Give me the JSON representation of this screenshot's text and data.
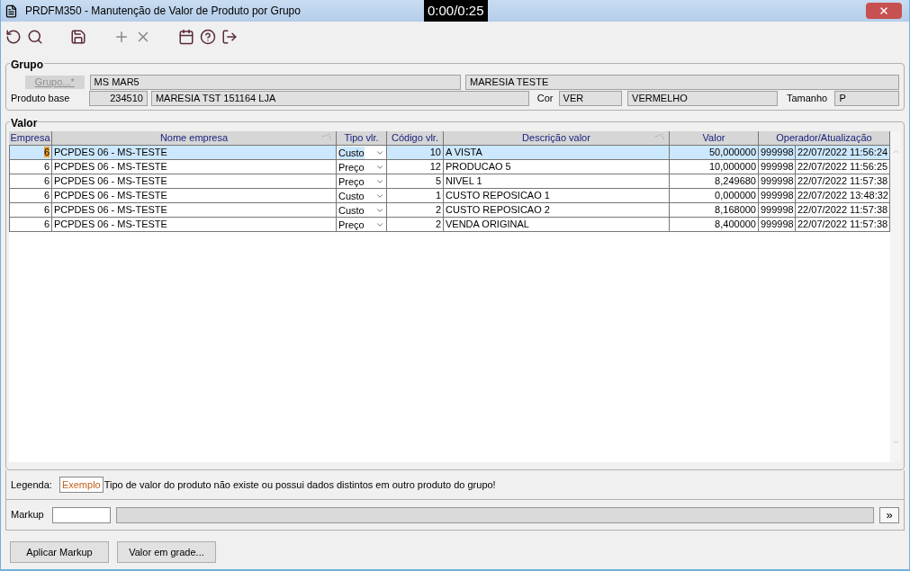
{
  "window": {
    "title": "PRDFM350 - Manutenção de Valor de Produto por Grupo"
  },
  "video_timer": "0:00/0:25",
  "grupo": {
    "legend": "Grupo",
    "button": "Grupo...*",
    "code": "MS MAR5",
    "name": "MARESIA TESTE",
    "produto_label": "Produto base",
    "produto_code": "234510",
    "produto_name": "MARESIA TST 151164 LJA",
    "cor_label": "Cor",
    "cor_code": "VER",
    "cor_name": "VERMELHO",
    "tamanho_label": "Tamanho",
    "tamanho": "P"
  },
  "valor": {
    "legend": "Valor",
    "columns": [
      {
        "label": "Empresa",
        "filter": false
      },
      {
        "label": "Nome empresa",
        "filter": true
      },
      {
        "label": "Tipo vlr.",
        "filter": false
      },
      {
        "label": "Código vlr.",
        "filter": false
      },
      {
        "label": "Descrição valor",
        "filter": true
      },
      {
        "label": "Valor",
        "filter": false
      },
      {
        "label": "Operador/Atualização",
        "filter": false
      }
    ],
    "rows": [
      {
        "selected": true,
        "empresa": "6",
        "nome": "PCPDES 06 - MS-TESTE",
        "tipo": "Custo",
        "codigo": "10",
        "descricao": "A VISTA",
        "valor": "50,000000",
        "operador": "999998",
        "atualizacao": "22/07/2022 11:56:24"
      },
      {
        "selected": false,
        "empresa": "6",
        "nome": "PCPDES 06 - MS-TESTE",
        "tipo": "Preço",
        "codigo": "12",
        "descricao": "PRODUCAO 5",
        "valor": "10,000000",
        "operador": "999998",
        "atualizacao": "22/07/2022 11:56:25"
      },
      {
        "selected": false,
        "empresa": "6",
        "nome": "PCPDES 06 - MS-TESTE",
        "tipo": "Preço",
        "codigo": "5",
        "descricao": "NIVEL 1",
        "valor": "8,249680",
        "operador": "999998",
        "atualizacao": "22/07/2022 11:57:38"
      },
      {
        "selected": false,
        "empresa": "6",
        "nome": "PCPDES 06 - MS-TESTE",
        "tipo": "Custo",
        "codigo": "1",
        "descricao": "CUSTO REPOSICAO 1",
        "valor": "0,000000",
        "operador": "999998",
        "atualizacao": "22/07/2022 13:48:32"
      },
      {
        "selected": false,
        "empresa": "6",
        "nome": "PCPDES 06 - MS-TESTE",
        "tipo": "Custo",
        "codigo": "2",
        "descricao": "CUSTO REPOSICAO 2",
        "valor": "8,168000",
        "operador": "999998",
        "atualizacao": "22/07/2022 11:57:38"
      },
      {
        "selected": false,
        "empresa": "6",
        "nome": "PCPDES 06 - MS-TESTE",
        "tipo": "Preço",
        "codigo": "2",
        "descricao": "VENDA ORIGINAL",
        "valor": "8,400000",
        "operador": "999998",
        "atualizacao": "22/07/2022 11:57:38"
      }
    ]
  },
  "legenda": {
    "label": "Legenda:",
    "sample": "Exemplo",
    "text": "Tipo de valor do produto não existe ou possui dados distintos em outro produto do grupo!"
  },
  "markup": {
    "label": "Markup",
    "button": "»"
  },
  "buttons": [
    "Aplicar Markup",
    "Valor em grade..."
  ]
}
